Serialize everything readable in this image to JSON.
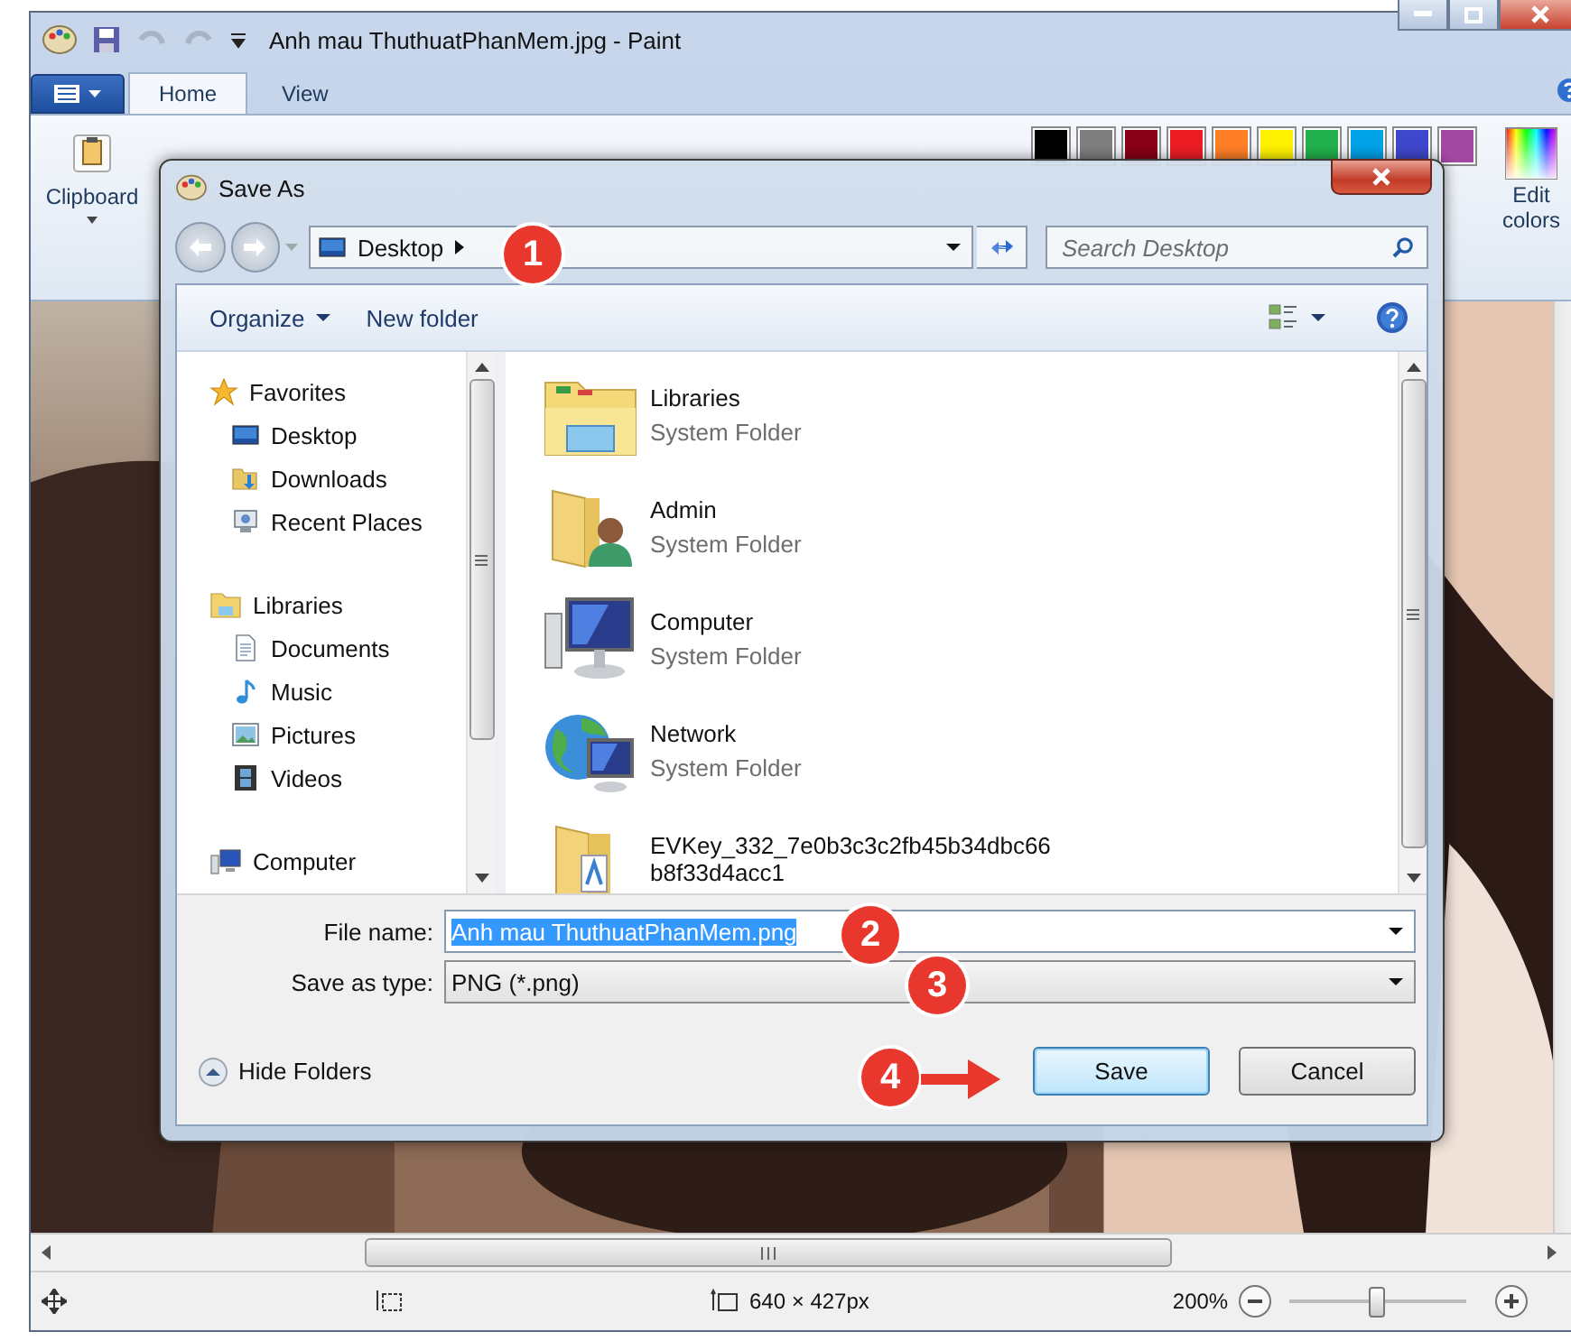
{
  "window": {
    "title": "Anh mau ThuthuatPhanMem.jpg - Paint"
  },
  "ribbon_tabs": [
    {
      "label": "Home",
      "selected": true
    },
    {
      "label": "View",
      "selected": false
    }
  ],
  "ribbon": {
    "clipboard_label": "Clipboard",
    "edit_colors_label": "Edit colors",
    "palette": [
      {
        "color": "#000000"
      },
      {
        "color": "#7f7f7f"
      },
      {
        "color": "#880015"
      },
      {
        "color": "#ed1c24"
      },
      {
        "color": "#ff7f27"
      },
      {
        "color": "#fff200"
      },
      {
        "color": "#22b14c"
      },
      {
        "color": "#00a2e8"
      },
      {
        "color": "#3f48cc"
      },
      {
        "color": "#a349a4"
      }
    ]
  },
  "dialog": {
    "title": "Save As",
    "address": "Desktop",
    "search_placeholder": "Search Desktop",
    "organize": "Organize",
    "new_folder": "New folder",
    "nav_tree": [
      {
        "label": "Favorites",
        "kind": "star",
        "children": [
          {
            "label": "Desktop",
            "kind": "desktop"
          },
          {
            "label": "Downloads",
            "kind": "downloads"
          },
          {
            "label": "Recent Places",
            "kind": "recent"
          }
        ]
      },
      {
        "label": "Libraries",
        "kind": "library",
        "children": [
          {
            "label": "Documents",
            "kind": "documents"
          },
          {
            "label": "Music",
            "kind": "music"
          },
          {
            "label": "Pictures",
            "kind": "pictures"
          },
          {
            "label": "Videos",
            "kind": "videos"
          }
        ]
      },
      {
        "label": "Computer",
        "kind": "computer"
      }
    ],
    "files": [
      {
        "name": "Libraries",
        "type": "System Folder",
        "kind": "library"
      },
      {
        "name": "Admin",
        "type": "System Folder",
        "kind": "user"
      },
      {
        "name": "Computer",
        "type": "System Folder",
        "kind": "computer"
      },
      {
        "name": "Network",
        "type": "System Folder",
        "kind": "network"
      },
      {
        "name": "EVKey_332_7e0b3c3c2fb45b34dbc66b8f33d4acc1",
        "kind": "folder"
      }
    ],
    "file_name": {
      "label": "File name:",
      "value": "Anh mau ThuthuatPhanMem.png",
      "text_selected": true
    },
    "save_as_type": {
      "label": "Save as type:",
      "value": "PNG (*.png)"
    },
    "hide_folders": "Hide Folders",
    "buttons": [
      {
        "label": "Save",
        "default": true
      },
      {
        "label": "Cancel",
        "default": false
      }
    ]
  },
  "annotations": [
    {
      "label": "1"
    },
    {
      "label": "2"
    },
    {
      "label": "3"
    },
    {
      "label": "4"
    }
  ],
  "status_bar": {
    "dimensions": "640 × 427px",
    "zoom": "200%",
    "level": 0.5
  }
}
